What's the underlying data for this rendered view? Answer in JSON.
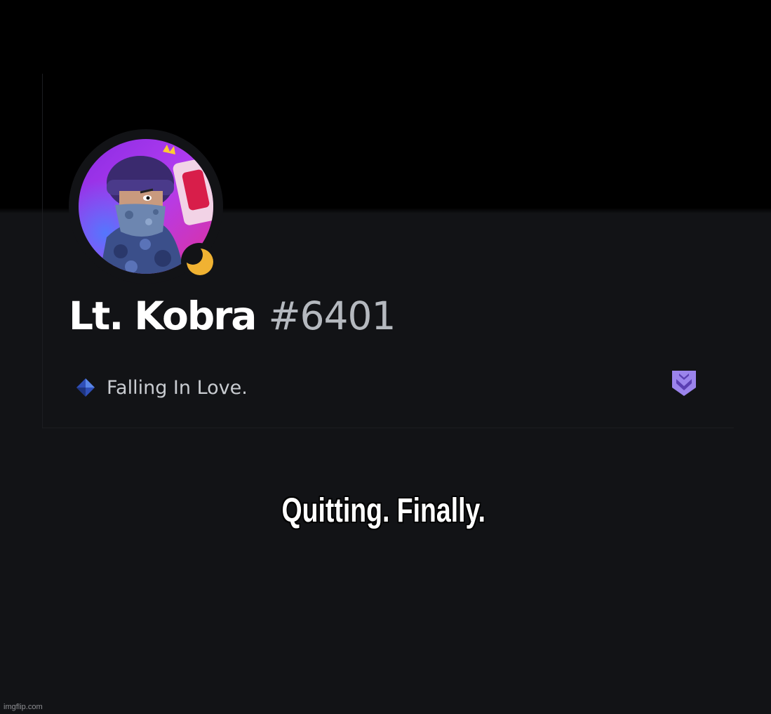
{
  "profile": {
    "username": "Lt. Kobra",
    "discriminator": "#6401",
    "custom_status": "Falling In Love.",
    "status": "idle",
    "avatar_icon": "avatar-image",
    "status_icon": "moon-icon",
    "gem_icon": "diamond-icon",
    "badge_icon": "hypesquad-badge-icon"
  },
  "caption": {
    "text": "Quitting. Finally."
  },
  "watermark": {
    "text": "imgflip.com"
  },
  "colors": {
    "background": "#121316",
    "banner": "#000000",
    "idle_status": "#f0b232",
    "badge": "#9b84ec",
    "gem": "#3b5ccc"
  }
}
